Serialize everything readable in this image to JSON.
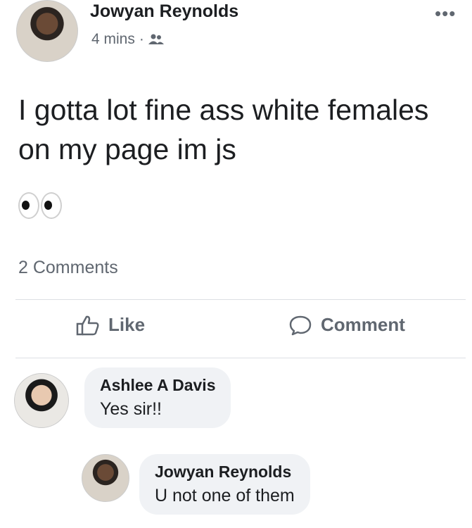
{
  "post": {
    "author": "Jowyan Reynolds",
    "time": "4 mins",
    "separator": "·",
    "privacy_icon": "friends-icon",
    "more_icon": "more-dots-icon",
    "text": "I gotta lot fine ass white females on my page im js",
    "emoji": "👀",
    "comment_count": "2 Comments"
  },
  "actions": {
    "like_label": "Like",
    "comment_label": "Comment"
  },
  "comments": [
    {
      "author": "Ashlee A Davis",
      "text": "Yes sir!!"
    },
    {
      "author": "Jowyan Reynolds",
      "text": "U not one of them"
    }
  ],
  "colors": {
    "text": "#1c1e21",
    "secondary": "#606770",
    "bubble": "#f0f2f5"
  }
}
